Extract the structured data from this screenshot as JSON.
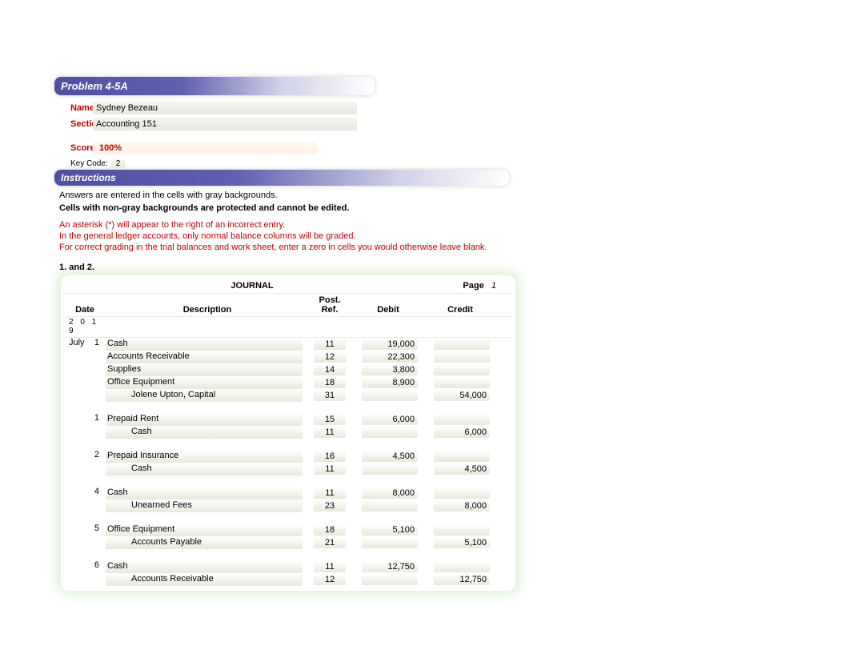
{
  "header": {
    "problem": "Problem 4-5A",
    "name_label": "Name:",
    "name_value": "Sydney Bezeau",
    "section_label": "Section:",
    "section_value": "Accounting 151",
    "score_label": "Score:",
    "score_value": "100%",
    "keycode_label": "Key Code:",
    "keycode_value": "2"
  },
  "instructions": {
    "title": "Instructions",
    "line1": "Answers are entered in the cells with gray backgrounds.",
    "line2": "Cells with non-gray backgrounds are protected and cannot be edited.",
    "line3": "An asterisk (*) will appear to the right of an incorrect entry.",
    "line4": "In the general ledger accounts, only normal balance columns will be graded.",
    "line5": "For correct grading in the trial balances and work sheet, enter a zero in cells you would otherwise leave blank."
  },
  "step_label": "1. and 2.",
  "journal": {
    "title": "JOURNAL",
    "page_label": "Page",
    "page_num": "1",
    "headers": {
      "date": "Date",
      "desc": "Description",
      "post": "Post.",
      "ref": "Ref.",
      "debit": "Debit",
      "credit": "Credit"
    },
    "year": "2 0 1 9",
    "month": "July",
    "groups": [
      {
        "day": "1",
        "rows": [
          {
            "desc": "Cash",
            "indent": 0,
            "ref": "11",
            "debit": "19,000",
            "credit": ""
          },
          {
            "desc": "Accounts Receivable",
            "indent": 0,
            "ref": "12",
            "debit": "22,300",
            "credit": ""
          },
          {
            "desc": "Supplies",
            "indent": 0,
            "ref": "14",
            "debit": "3,800",
            "credit": ""
          },
          {
            "desc": "Office Equipment",
            "indent": 0,
            "ref": "18",
            "debit": "8,900",
            "credit": ""
          },
          {
            "desc": "Jolene Upton, Capital",
            "indent": 1,
            "ref": "31",
            "debit": "",
            "credit": "54,000"
          }
        ]
      },
      {
        "day": "1",
        "rows": [
          {
            "desc": "Prepaid Rent",
            "indent": 0,
            "ref": "15",
            "debit": "6,000",
            "credit": ""
          },
          {
            "desc": "Cash",
            "indent": 1,
            "ref": "11",
            "debit": "",
            "credit": "6,000"
          }
        ]
      },
      {
        "day": "2",
        "rows": [
          {
            "desc": "Prepaid Insurance",
            "indent": 0,
            "ref": "16",
            "debit": "4,500",
            "credit": ""
          },
          {
            "desc": "Cash",
            "indent": 1,
            "ref": "11",
            "debit": "",
            "credit": "4,500"
          }
        ]
      },
      {
        "day": "4",
        "rows": [
          {
            "desc": "Cash",
            "indent": 0,
            "ref": "11",
            "debit": "8,000",
            "credit": ""
          },
          {
            "desc": "Unearned Fees",
            "indent": 1,
            "ref": "23",
            "debit": "",
            "credit": "8,000"
          }
        ]
      },
      {
        "day": "5",
        "rows": [
          {
            "desc": "Office Equipment",
            "indent": 0,
            "ref": "18",
            "debit": "5,100",
            "credit": ""
          },
          {
            "desc": "Accounts Payable",
            "indent": 1,
            "ref": "21",
            "debit": "",
            "credit": "5,100"
          }
        ]
      },
      {
        "day": "6",
        "rows": [
          {
            "desc": "Cash",
            "indent": 0,
            "ref": "11",
            "debit": "12,750",
            "credit": ""
          },
          {
            "desc": "Accounts Receivable",
            "indent": 1,
            "ref": "12",
            "debit": "",
            "credit": "12,750"
          }
        ]
      }
    ]
  }
}
